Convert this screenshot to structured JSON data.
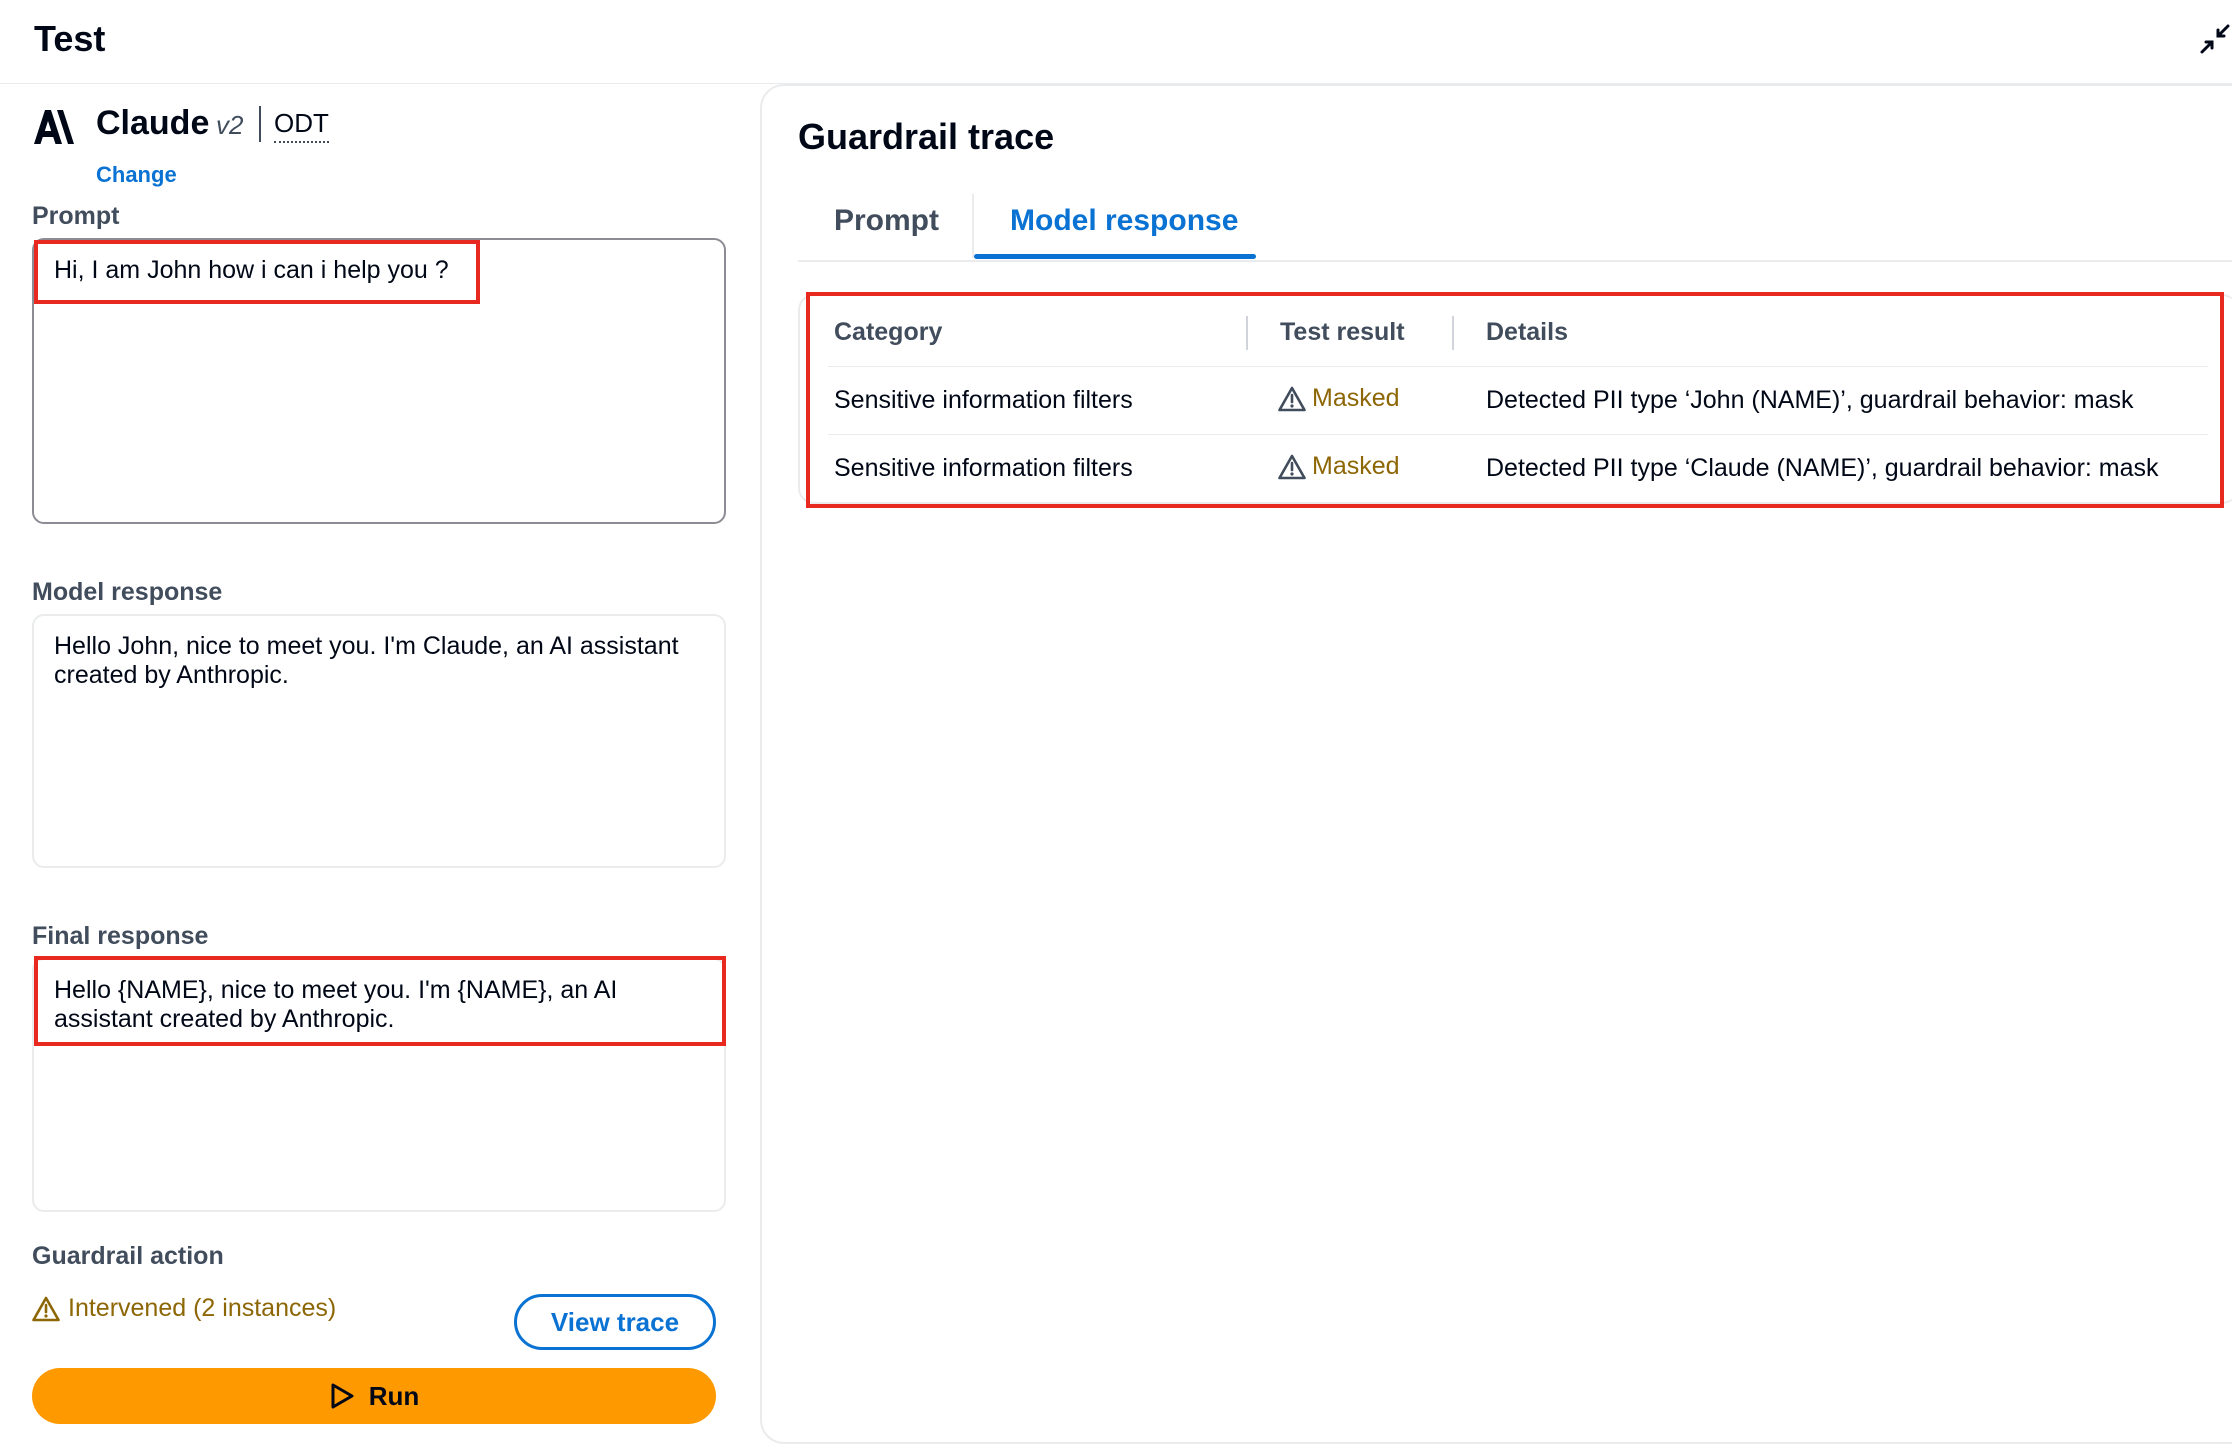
{
  "header": {
    "title": "Test"
  },
  "model": {
    "name": "Claude",
    "version": "v2",
    "tag": "ODT",
    "change_label": "Change"
  },
  "prompt": {
    "label": "Prompt",
    "value": "Hi, I am John how i can i help you ?"
  },
  "model_response": {
    "label": "Model response",
    "value": "Hello John, nice to meet you. I'm Claude, an AI assistant created by Anthropic."
  },
  "final_response": {
    "label": "Final response",
    "value": "Hello {NAME}, nice to meet you. I'm {NAME}, an AI assistant created by Anthropic."
  },
  "guardrail_action": {
    "label": "Guardrail action",
    "status": "Intervened (2 instances)",
    "view_trace_label": "View trace"
  },
  "run": {
    "label": "Run"
  },
  "trace": {
    "title": "Guardrail trace",
    "tabs": [
      {
        "label": "Prompt"
      },
      {
        "label": "Model response"
      }
    ],
    "columns": [
      "Category",
      "Test result",
      "Details"
    ],
    "rows": [
      {
        "category": "Sensitive information filters",
        "result": "Masked",
        "details": "Detected PII type ‘John (NAME)’, guardrail behavior: mask"
      },
      {
        "category": "Sensitive information filters",
        "result": "Masked",
        "details": "Detected PII type ‘Claude (NAME)’, guardrail behavior: mask"
      }
    ]
  },
  "colors": {
    "accent": "#0972d3",
    "warning": "#8d6605",
    "run_button": "#ff9900",
    "highlight": "#e8291f"
  }
}
